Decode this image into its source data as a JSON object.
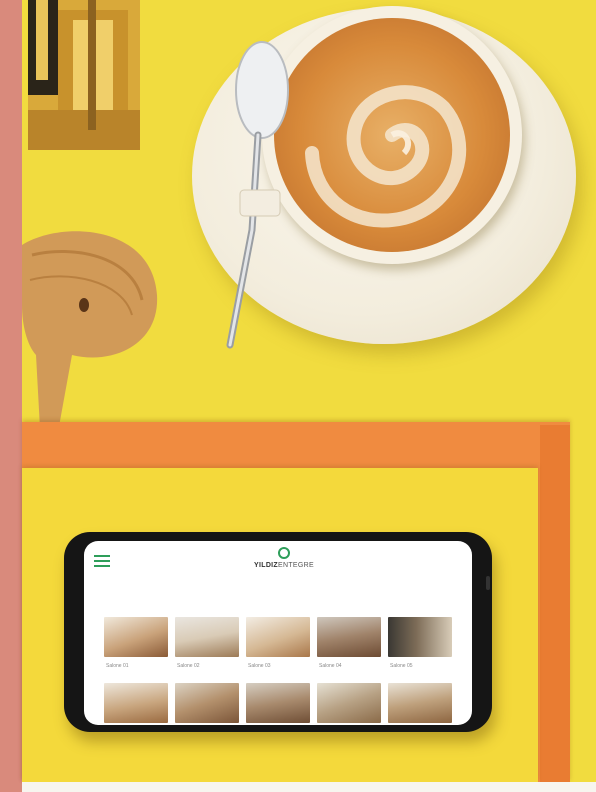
{
  "phone_screen": {
    "brand": {
      "name_bold": "YILDIZ",
      "name_rest": "ENTEGRE"
    },
    "row1_labels": [
      "Salone 01",
      "Salone 02",
      "Salone 03",
      "Salone 04",
      "Salone 05"
    ],
    "colors": {
      "accent": "#2e9e5a"
    }
  },
  "scene": {
    "colors": {
      "background_yellow": "#f1dc3f",
      "orange_board": "#f08b40",
      "left_strip": "#d98a7c"
    }
  }
}
